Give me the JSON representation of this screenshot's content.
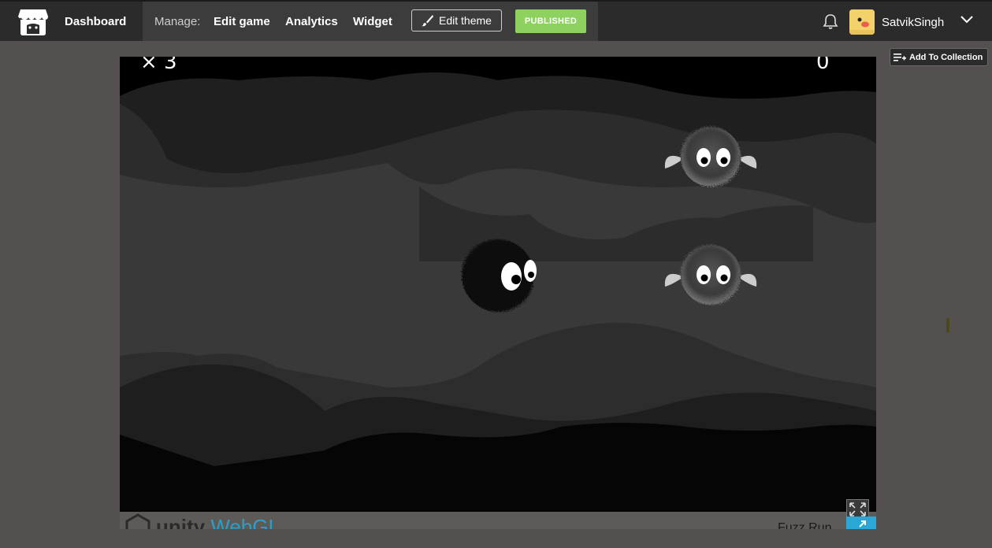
{
  "topbar": {
    "dashboard_label": "Dashboard",
    "manage_label": "Manage:",
    "links": [
      "Edit game",
      "Analytics",
      "Widget"
    ],
    "edit_theme_label": "Edit theme",
    "status_badge": "PUBLISHED",
    "username": "SatvikSingh",
    "icons": [
      "itch-logo-icon",
      "brush-icon",
      "bell-icon",
      "chevron-down-icon"
    ]
  },
  "collection": {
    "label": "Add To Collection",
    "icon": "playlist-add-icon"
  },
  "game": {
    "lives_text": "× 3",
    "score_text": "0",
    "engine_brand": "unity",
    "engine_suffix": "WebGL",
    "title_partial": "Fuzz Run",
    "icons": [
      "fullscreen-icon",
      "external-link-icon"
    ]
  },
  "colors": {
    "badge": "#8dd25f",
    "accent": "#2aa7d6",
    "topbar": "#2b2b2b",
    "background": "#545050"
  }
}
